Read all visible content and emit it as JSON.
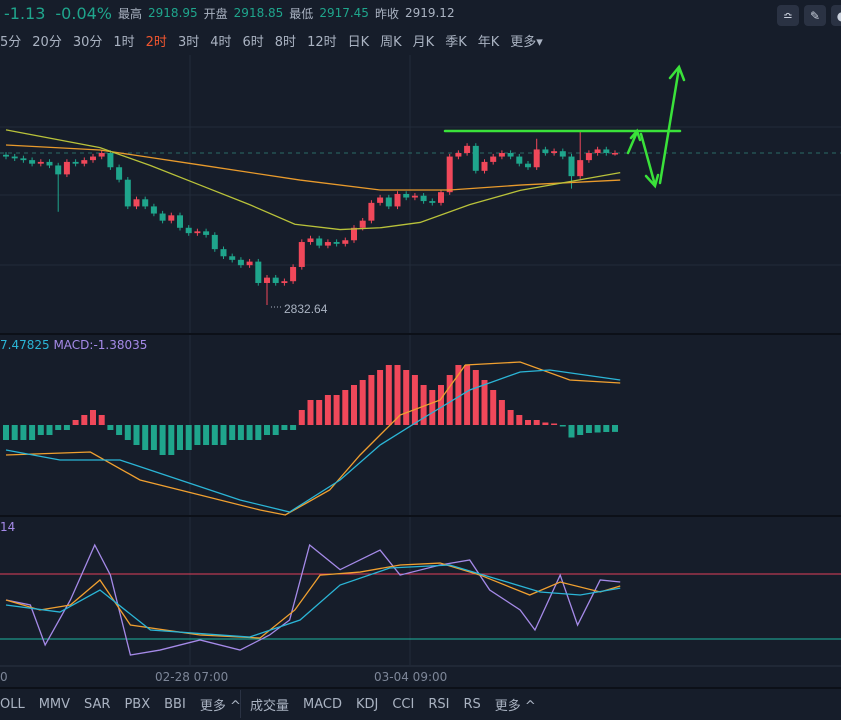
{
  "header": {
    "change": "-1.13",
    "change_pct": "-0.04%",
    "high_label": "最高",
    "high": "2918.95",
    "open_label": "开盘",
    "open": "2918.85",
    "low_label": "最低",
    "low": "2917.45",
    "prev_close_label": "昨收",
    "prev_close": "2919.12"
  },
  "periods": [
    "5分",
    "20分",
    "30分",
    "1时",
    "2时",
    "3时",
    "4时",
    "6时",
    "8时",
    "12时",
    "日K",
    "周K",
    "月K",
    "季K",
    "年K",
    "更多▾"
  ],
  "active_period": "2时",
  "toolbar_icons": [
    "indicator-icon",
    "draw-icon",
    "more-icon"
  ],
  "macd_panel": {
    "dea_label": "7.47825",
    "macd_label": "MACD:-1.38035"
  },
  "kdj_panel": {
    "label": "14"
  },
  "x_axis": [
    "0",
    "02-28 07:00",
    "03-04 09:00"
  ],
  "bottom_left": [
    "OLL",
    "MMV",
    "SAR",
    "PBX",
    "BBI",
    "更多 ^"
  ],
  "bottom_right": [
    "成交量",
    "MACD",
    "KDJ",
    "CCI",
    "RSI",
    "RS",
    "更多 ^"
  ],
  "low_marker": "2832.64",
  "colors": {
    "up": "#f0485a",
    "down": "#1fa58c",
    "ma_long": "#e89a2c",
    "ma_short": "#b9c23a",
    "dif": "#f0a030",
    "dea": "#2bb5d6",
    "j": "#a58ae8",
    "annotation": "#3ae23a"
  },
  "chart_data": {
    "type": "candlestick",
    "current_price": 2918,
    "closes": [
      2916,
      2915,
      2914,
      2912,
      2913,
      2911,
      2906,
      2913,
      2912,
      2914,
      2916,
      2918,
      2910,
      2903,
      2888,
      2892,
      2888,
      2884,
      2880,
      2883,
      2876,
      2873,
      2874,
      2872,
      2864,
      2860,
      2858,
      2855,
      2857,
      2845,
      2848,
      2845,
      2846,
      2854,
      2868,
      2870,
      2866,
      2868,
      2867,
      2869,
      2876,
      2880,
      2890,
      2893,
      2888,
      2895,
      2893,
      2894,
      2891,
      2890,
      2896,
      2916,
      2918,
      2922,
      2908,
      2913,
      2916,
      2918,
      2916,
      2912,
      2910,
      2920,
      2918,
      2919,
      2916,
      2905,
      2914,
      2918,
      2920,
      2918,
      2918
    ],
    "first_open": 2917,
    "wick_overrides": {
      "6": {
        "low": 2885
      },
      "30": {
        "low": 2832.64
      },
      "65": {
        "low": 2898
      },
      "66": {
        "high": 2930
      },
      "61": {
        "high": 2926
      }
    },
    "resistance": 2930,
    "ma_long": [
      [
        0,
        2922.5
      ],
      [
        10.8,
        2919.7
      ],
      [
        22.3,
        2911.3
      ],
      [
        33.8,
        2902.8
      ],
      [
        43,
        2897.2
      ],
      [
        51,
        2897.2
      ],
      [
        59.1,
        2900
      ],
      [
        70.6,
        2902.8
      ]
    ],
    "ma_short": [
      [
        0,
        2931
      ],
      [
        10.8,
        2921
      ],
      [
        16.6,
        2911
      ],
      [
        22.3,
        2900
      ],
      [
        28,
        2889
      ],
      [
        33.2,
        2878
      ],
      [
        38.4,
        2875
      ],
      [
        43,
        2876
      ],
      [
        47.6,
        2879
      ],
      [
        53.3,
        2889
      ],
      [
        59.1,
        2897
      ],
      [
        66,
        2903
      ],
      [
        70.6,
        2907
      ]
    ],
    "macd_hist": [
      -3,
      -3,
      -3,
      -3,
      -2,
      -2,
      -1,
      -1,
      1,
      2,
      3,
      2,
      -1,
      -2,
      -3,
      -4,
      -5,
      -5,
      -6,
      -6,
      -5,
      -5,
      -4,
      -4,
      -4,
      -4,
      -3,
      -3,
      -3,
      -3,
      -2,
      -2,
      -1,
      -1,
      3,
      5,
      5,
      6,
      6,
      7,
      8,
      9,
      10,
      11,
      12,
      12,
      11,
      10,
      8,
      7,
      8,
      10,
      12,
      12,
      11,
      9,
      7,
      5,
      3,
      2,
      1,
      1,
      0.5,
      0.3,
      -0.3,
      -2.5,
      -2,
      -1.6,
      -1.5,
      -1.4,
      -1.38
    ],
    "dif": [
      [
        0,
        -6
      ],
      [
        9.7,
        -5.4
      ],
      [
        15.4,
        -11
      ],
      [
        22.3,
        -14
      ],
      [
        29.2,
        -17
      ],
      [
        32.1,
        -18
      ],
      [
        37.2,
        -13
      ],
      [
        40.7,
        -6
      ],
      [
        45.3,
        2
      ],
      [
        49.9,
        5
      ],
      [
        52.8,
        12
      ],
      [
        59.1,
        12.6
      ],
      [
        64.8,
        9
      ],
      [
        70.6,
        8.4
      ]
    ],
    "dea": [
      [
        0,
        -5
      ],
      [
        6.2,
        -7
      ],
      [
        13.1,
        -7
      ],
      [
        20,
        -11
      ],
      [
        26.9,
        -15
      ],
      [
        32.6,
        -17.4
      ],
      [
        38.4,
        -11
      ],
      [
        43,
        -4
      ],
      [
        47.6,
        1
      ],
      [
        53.3,
        7
      ],
      [
        59.1,
        10.6
      ],
      [
        62.5,
        11
      ],
      [
        70.6,
        9
      ]
    ],
    "kdj_levels": [
      80,
      20
    ],
    "k": [
      [
        0,
        56
      ],
      [
        3.9,
        46.8
      ],
      [
        7.4,
        51.4
      ],
      [
        10.8,
        74.5
      ],
      [
        14.3,
        32.9
      ],
      [
        22.3,
        23.7
      ],
      [
        29.2,
        20.9
      ],
      [
        33.2,
        46.8
      ],
      [
        36.1,
        79
      ],
      [
        40.7,
        81.8
      ],
      [
        45.3,
        88.3
      ],
      [
        49.9,
        90.1
      ],
      [
        54.5,
        79
      ],
      [
        60.2,
        60.6
      ],
      [
        63.7,
        72.6
      ],
      [
        68.3,
        63.4
      ],
      [
        70.6,
        68.9
      ]
    ],
    "d": [
      [
        0,
        51.4
      ],
      [
        6.2,
        44.9
      ],
      [
        10.8,
        65.2
      ],
      [
        16.6,
        28.3
      ],
      [
        28,
        21.8
      ],
      [
        33.8,
        37.5
      ],
      [
        38.4,
        69.8
      ],
      [
        44.1,
        85.5
      ],
      [
        51,
        88.3
      ],
      [
        56.8,
        74.5
      ],
      [
        61.4,
        63.4
      ],
      [
        66,
        60.6
      ],
      [
        70.6,
        67
      ]
    ],
    "j": [
      [
        0,
        56
      ],
      [
        2.8,
        51.4
      ],
      [
        4.5,
        14.5
      ],
      [
        7.4,
        56
      ],
      [
        10.2,
        106.8
      ],
      [
        12,
        79
      ],
      [
        14.3,
        5.2
      ],
      [
        17.7,
        9.8
      ],
      [
        22.3,
        19.1
      ],
      [
        26.9,
        9.8
      ],
      [
        30.3,
        23.7
      ],
      [
        32.6,
        37.5
      ],
      [
        34.9,
        106.8
      ],
      [
        38.4,
        84
      ],
      [
        43,
        102.1
      ],
      [
        45.3,
        79
      ],
      [
        49.9,
        88.3
      ],
      [
        53.3,
        92.9
      ],
      [
        55.6,
        65.2
      ],
      [
        59.1,
        46.8
      ],
      [
        60.8,
        28.3
      ],
      [
        63.7,
        79
      ],
      [
        65.7,
        32.9
      ],
      [
        68.3,
        74.5
      ],
      [
        70.6,
        72.6
      ]
    ]
  }
}
